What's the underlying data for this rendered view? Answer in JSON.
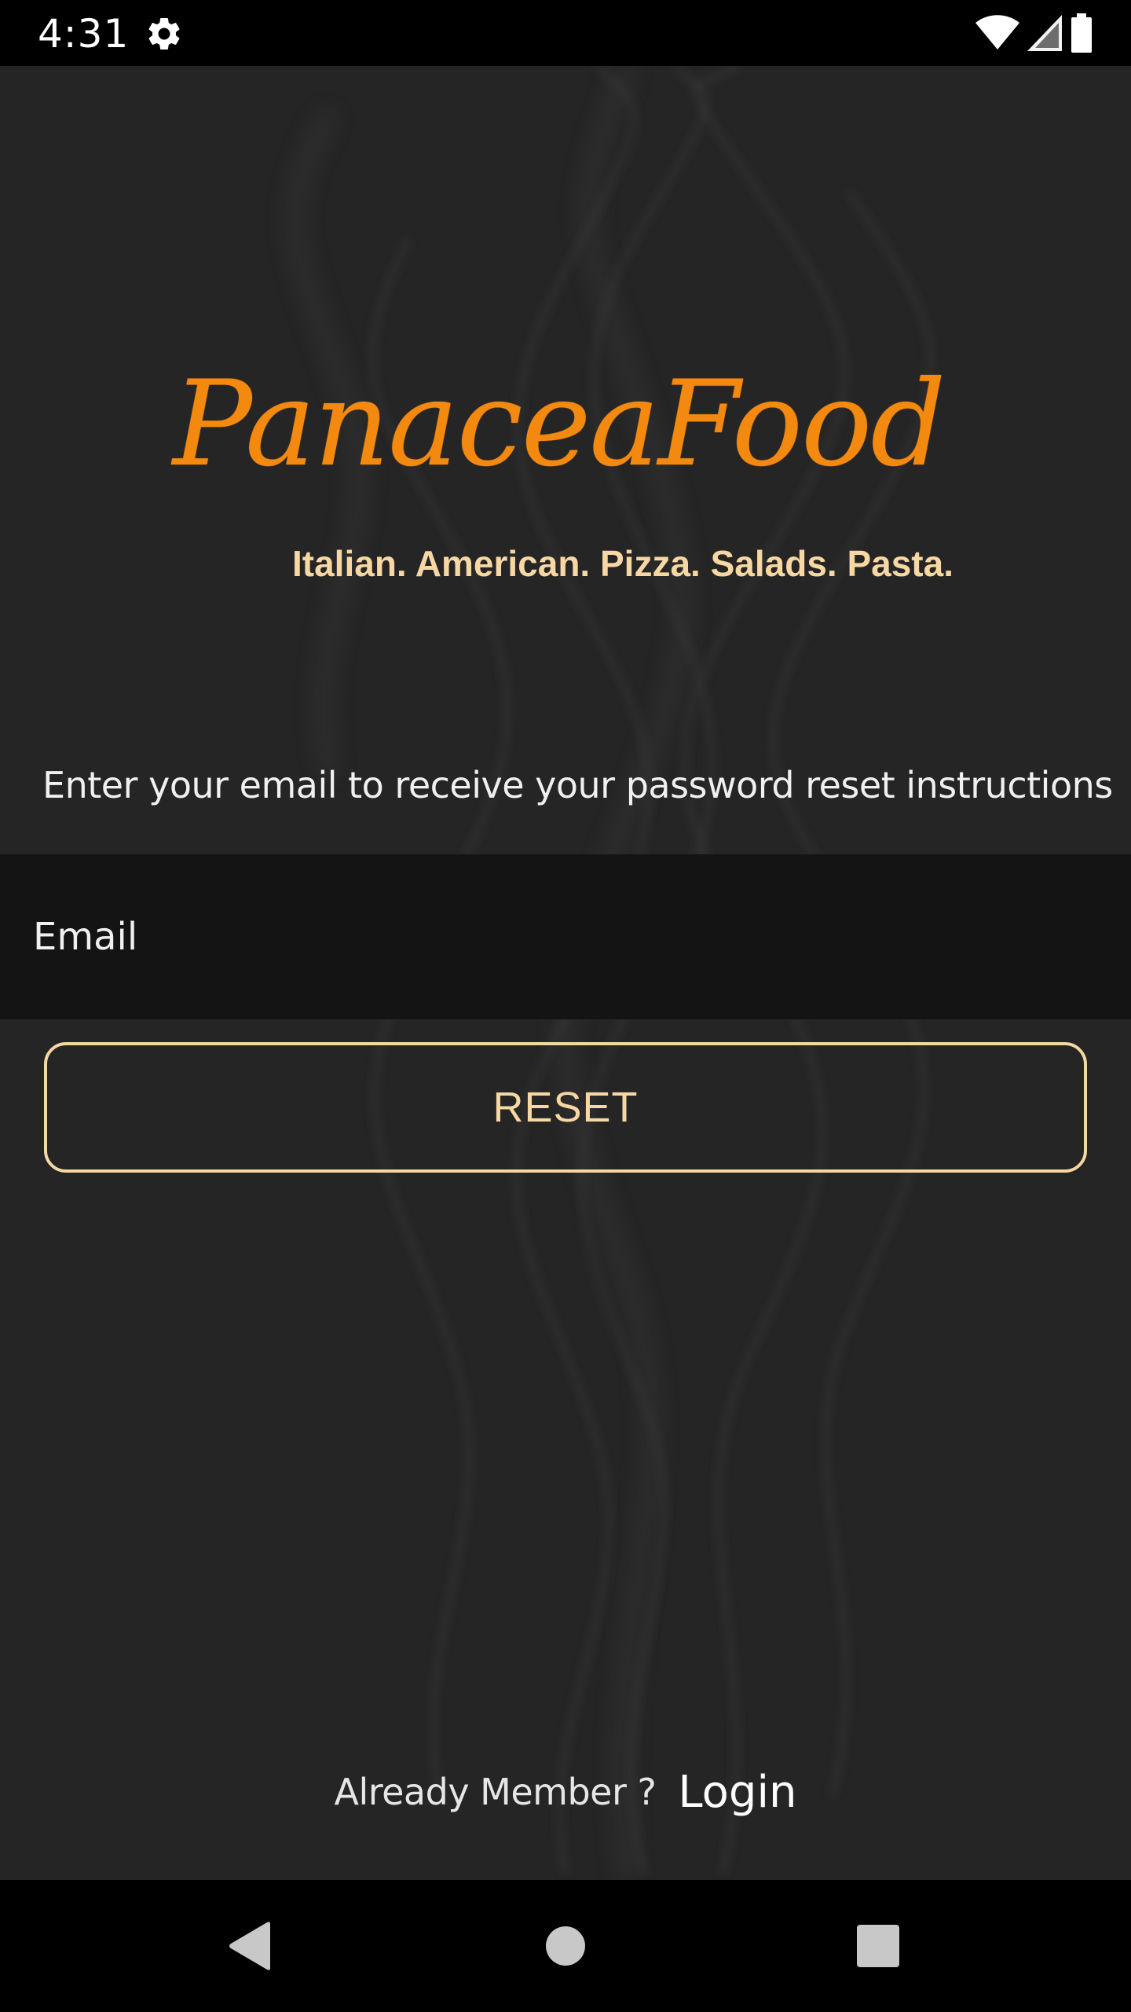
{
  "status_bar": {
    "time": "4:31",
    "settings_icon": "gear-icon",
    "wifi_icon": "wifi-icon",
    "signal_icon": "cell-signal-icon",
    "battery_icon": "battery-icon"
  },
  "brand": {
    "logo_text": "PanaceaFood",
    "tagline": "Italian. American. Pizza. Salads. Pasta.",
    "logo_color": "#f4890f",
    "accent_color": "#f7d7a3"
  },
  "reset_form": {
    "instructions": "Enter your email to receive your password reset instructions",
    "email_placeholder": "Email",
    "email_value": "",
    "reset_label": "RESET"
  },
  "footer": {
    "already_member": "Already Member ?",
    "login_label": "Login"
  },
  "nav_bar": {
    "back_icon": "back-icon",
    "home_icon": "home-icon",
    "recents_icon": "recents-icon"
  }
}
